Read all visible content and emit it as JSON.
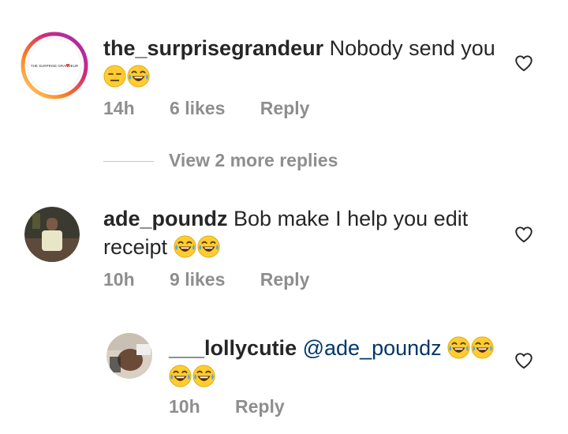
{
  "comments": [
    {
      "username": "the_surprisegrandeur",
      "text": "Nobody send you",
      "avatar_text": "THE SURPRISE GRANDEUR",
      "time": "14h",
      "likes": "6 likes",
      "reply": "Reply"
    },
    {
      "username": "ade_poundz",
      "text_line1": "Bob make I help you edit",
      "text_line2": "receipt",
      "time": "10h",
      "likes": "9 likes",
      "reply": "Reply"
    }
  ],
  "view_more": "View 2 more replies",
  "reply_comment": {
    "username": "___lollycutie",
    "mention": "@ade_poundz",
    "time": "10h",
    "reply": "Reply"
  },
  "colors": {
    "text": "#262626",
    "meta": "#8e8e8e",
    "mention": "#00376b",
    "story_ring": [
      "#feda75",
      "#fa7e1e",
      "#d62976",
      "#962fbf"
    ]
  }
}
